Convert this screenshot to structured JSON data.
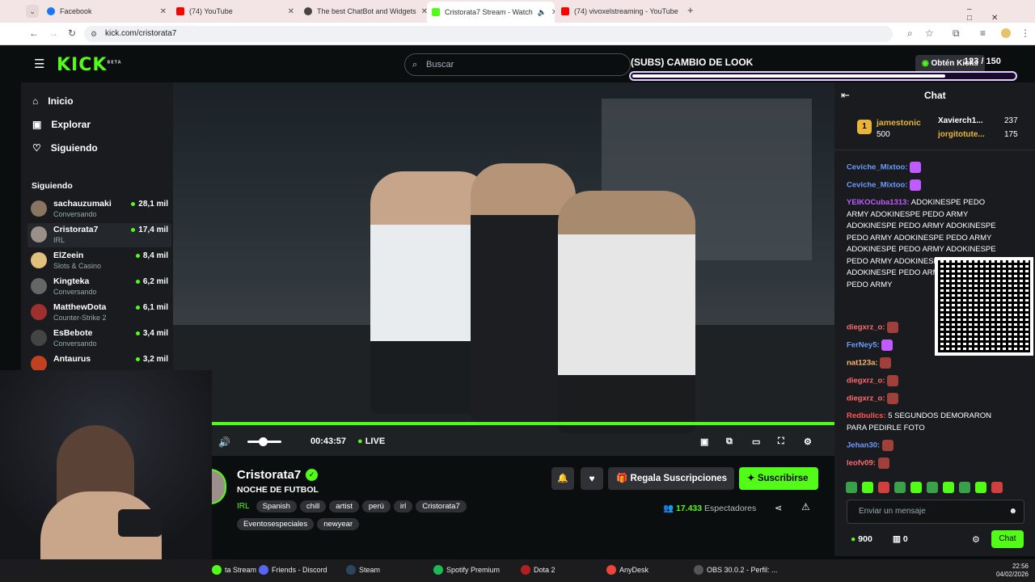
{
  "browser": {
    "tabs": [
      {
        "label": "Facebook",
        "color": "#1877f2"
      },
      {
        "label": "(74) YouTube",
        "color": "#ff0000"
      },
      {
        "label": "The best ChatBot and Widgets",
        "color": "#444444"
      },
      {
        "label": "Cristorata7 Stream - Watch",
        "color": "#53fc18"
      },
      {
        "label": "(74) vivoxelstreaming - YouTube",
        "color": "#ff0000"
      }
    ],
    "url": "kick.com/cristorata7"
  },
  "kick": {
    "logo": "KICK",
    "logo_badge": "BETA",
    "search_placeholder": "Buscar",
    "get_kicks": "Obtén Kicks",
    "goal": {
      "label": "(SUBS) CAMBIO DE LOOK",
      "count": "123 / 150",
      "progress": 0.82
    },
    "nav": [
      {
        "label": "Inicio",
        "icon": "home-icon"
      },
      {
        "label": "Explorar",
        "icon": "compass-icon"
      },
      {
        "label": "Siguiendo",
        "icon": "heart-icon"
      }
    ],
    "following_title": "Siguiendo",
    "following": [
      {
        "name": "sachauzumaki",
        "category": "Conversando",
        "viewers": "28,1 mil"
      },
      {
        "name": "Cristorata7",
        "category": "IRL",
        "viewers": "17,4 mil"
      },
      {
        "name": "ElZeein",
        "category": "Slots & Casino",
        "viewers": "8,4 mil"
      },
      {
        "name": "Kingteka",
        "category": "Conversando",
        "viewers": "6,2 mil"
      },
      {
        "name": "MatthewDota",
        "category": "Counter-Strike 2",
        "viewers": "6,1 mil"
      },
      {
        "name": "EsBebote",
        "category": "Conversando",
        "viewers": "3,4 mil"
      },
      {
        "name": "Antaurus",
        "category": "",
        "viewers": "3,2 mil"
      }
    ],
    "player": {
      "time": "00:43:57",
      "live": "LIVE",
      "volume": 0.45
    },
    "stream": {
      "channel": "Cristorata7",
      "title": "NOCHE DE FUTBOL",
      "category": "IRL",
      "tags": [
        "Spanish",
        "chill",
        "artist",
        "perú",
        "irl",
        "Cristorata7"
      ],
      "tags2": [
        "Eventosespeciales",
        "newyear"
      ],
      "gift": "Regala Suscripciones",
      "subscribe": "Suscribirse",
      "viewers": "17.433",
      "viewers_label": "Espectadores"
    },
    "chat": {
      "title": "Chat",
      "top": [
        {
          "rank": "1",
          "name": "jamestonic",
          "amount": "500"
        },
        {
          "name": "Xavierch1...",
          "amount": "237"
        },
        {
          "name": "jorgitotute...",
          "amount": "175"
        }
      ],
      "messages": [
        {
          "user": "Ceviche_Mixtoo:",
          "text": "",
          "color": "#6b9cff"
        },
        {
          "user": "Ceviche_Mixtoo:",
          "text": "",
          "color": "#6b9cff"
        },
        {
          "user": "YEIKOCuba1313:",
          "text": "ADOKINESPE PEDO ARMY ADOKINESPE PEDO ARMY ADOKINESPE PEDO ARMY ADOKINESPE PEDO ARMY ADOKINESPE PEDO ARMY ADOKINESPE PEDO ARMY ADOKINESPE PEDO ARMY ADOKINESPE PEDO ARMY ADOKINESPE PEDO ARMY ADOKINESPE PEDO ARMY",
          "color": "#c05cff"
        },
        {
          "user": "diegxrz_o:",
          "text": "",
          "color": "#ff6b6b"
        },
        {
          "user": "FerNey5:",
          "text": "",
          "color": "#6b9cff"
        },
        {
          "user": "nat123a:",
          "text": "",
          "color": "#ffb86b"
        },
        {
          "user": "diegxrz_o:",
          "text": "",
          "color": "#ff6b6b"
        },
        {
          "user": "diegxrz_o:",
          "text": "",
          "color": "#ff6b6b"
        },
        {
          "user": "Redbullcs:",
          "text": "5 SEGUNDOS DEMORARON PARA PEDIRLE FOTO",
          "color": "#ff5555"
        },
        {
          "user": "Jehan30:",
          "text": "",
          "color": "#6b9cff"
        },
        {
          "user": "leofv09:",
          "text": "",
          "color": "#ff6b6b"
        }
      ],
      "input_placeholder": "Enviar un mensaje",
      "points": "900",
      "items": "0",
      "send": "Chat"
    }
  },
  "taskbar": {
    "items": [
      {
        "label": "ta Stream ...",
        "color": "#53fc18"
      },
      {
        "label": "Friends - Discord",
        "color": "#5865f2"
      },
      {
        "label": "Steam",
        "color": "#2a475e"
      },
      {
        "label": "Spotify Premium",
        "color": "#1db954"
      },
      {
        "label": "Dota 2",
        "color": "#b02020"
      },
      {
        "label": "AnyDesk",
        "color": "#ef443b"
      },
      {
        "label": "OBS 30.0.2 - Perfil: ...",
        "color": "#555555"
      }
    ],
    "time": "22:56",
    "date": "04/02/2026"
  }
}
